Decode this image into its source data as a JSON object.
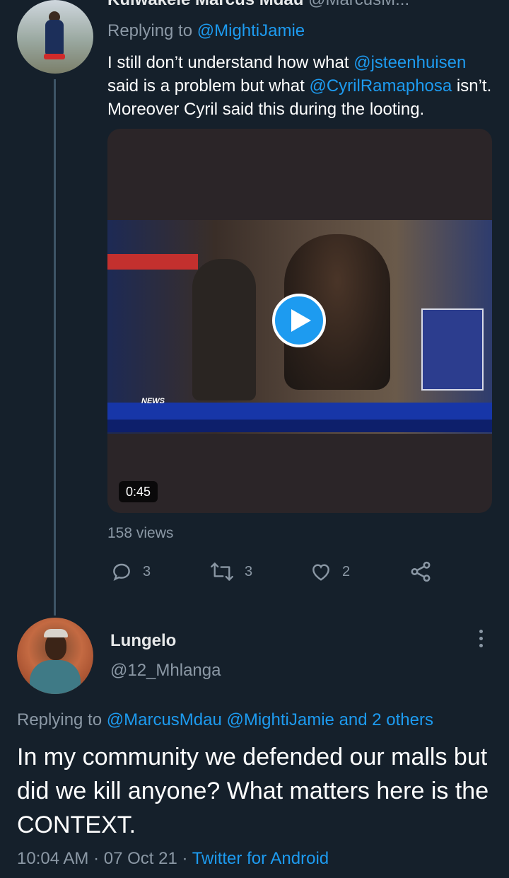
{
  "tweet1": {
    "header_partial": {
      "name": "Kulwakele Marcus Mdau",
      "handle": "@MarcusM..."
    },
    "replying_prefix": "Replying to",
    "replying_handle": "@MightiJamie",
    "text_1": "I still don’t understand how what ",
    "mention_1": "@jsteenhuisen",
    "text_2": " said is a problem but what ",
    "mention_2": "@CyrilRamaphosa",
    "text_3": " isn’t. Moreover Cyril said this during the looting.",
    "video": {
      "duration": "0:45",
      "overlay_text": "NEWS"
    },
    "views": "158 views",
    "actions": {
      "replies": "3",
      "retweets": "3",
      "likes": "2"
    }
  },
  "tweet2": {
    "name": "Lungelo",
    "handle": "@12_Mhlanga",
    "replying_prefix": "Replying to",
    "replying_targets": "@MarcusMdau @MightiJamie and 2 others",
    "text": "In my community we defended our malls but did we kill anyone? What matters here is the CONTEXT.",
    "time": "10:04 AM",
    "date": "07 Oct 21",
    "source": "Twitter for Android",
    "separator": "·"
  },
  "colors": {
    "background": "#15202b",
    "accent": "#1d9bf0",
    "muted": "#8b98a5"
  },
  "icons": [
    "reply-icon",
    "retweet-icon",
    "like-icon",
    "share-icon",
    "more-icon",
    "play-icon"
  ]
}
